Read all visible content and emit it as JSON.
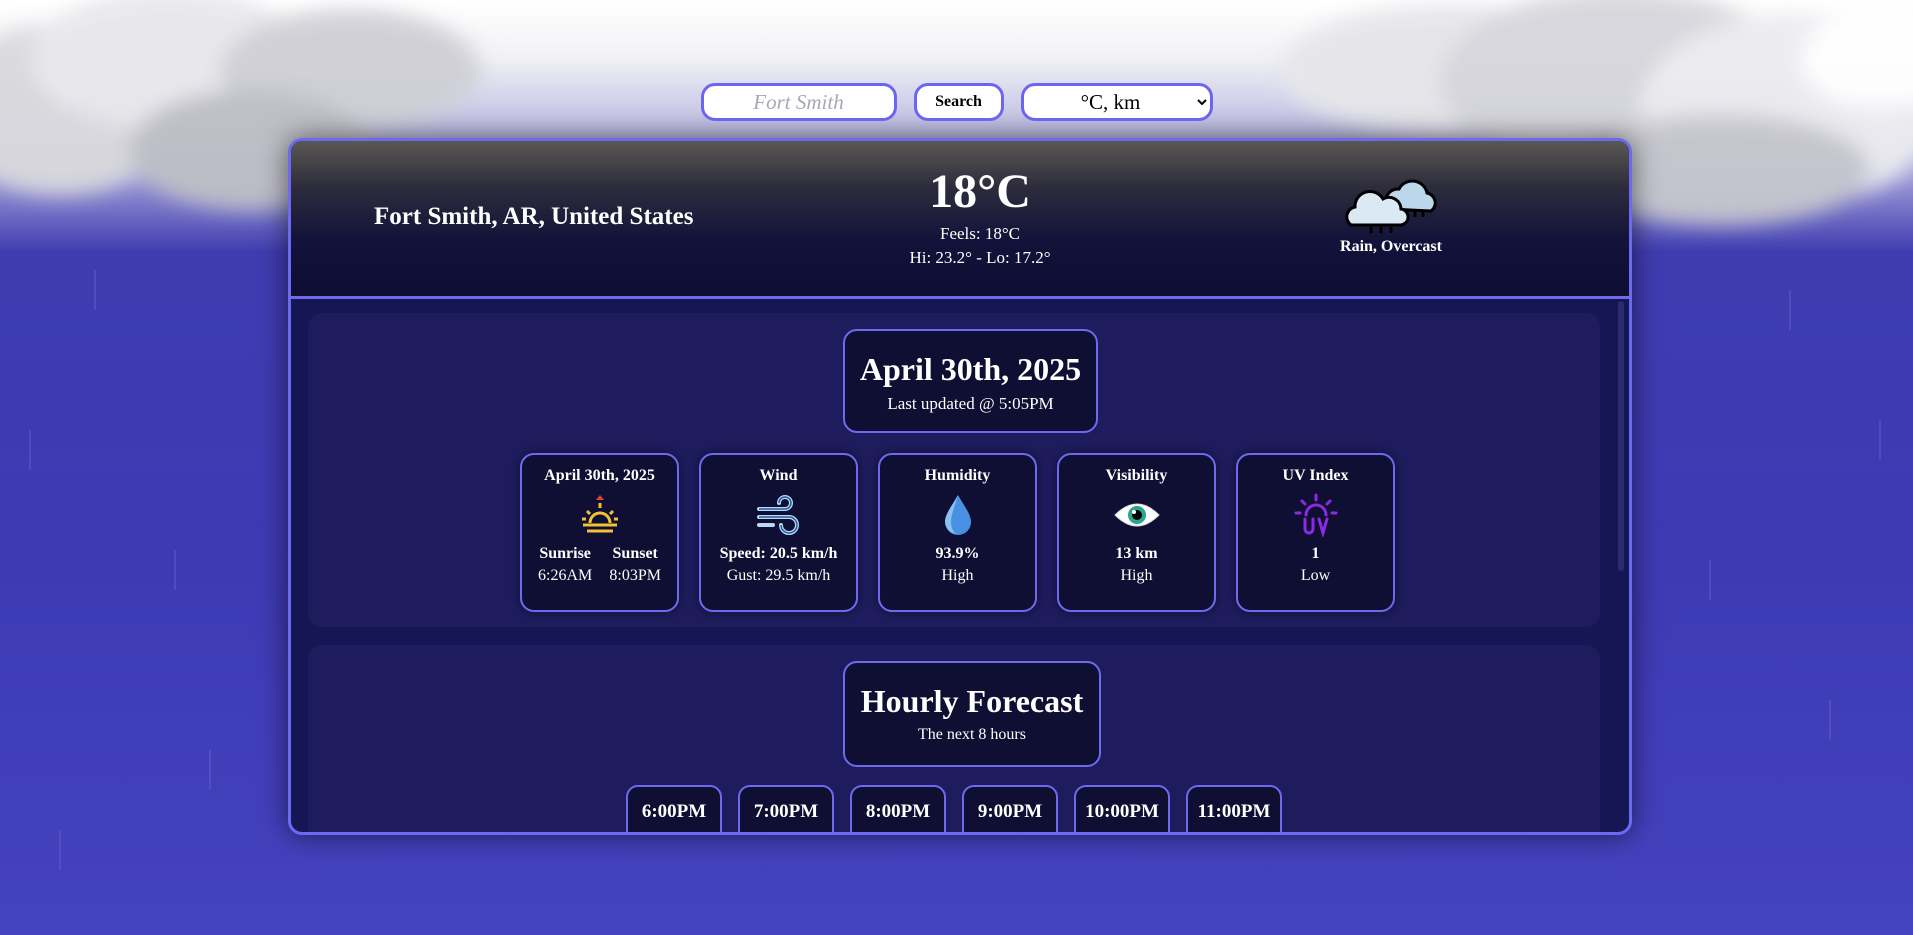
{
  "search": {
    "placeholder": "Fort Smith",
    "button_label": "Search",
    "unit_selected": "°C, km"
  },
  "current": {
    "location": "Fort Smith, AR, United States",
    "temperature": "18°C",
    "feels_like": "Feels: 18°C",
    "hi_lo": "Hi: 23.2° - Lo: 17.2°",
    "condition": "Rain, Overcast",
    "condition_icon": "rain-cloud-icon"
  },
  "today": {
    "date": "April 30th, 2025",
    "last_updated": "Last updated @ 5:05PM"
  },
  "stats": {
    "sun": {
      "title": "April 30th, 2025",
      "icon": "sunrise-icon",
      "sunrise_label": "Sunrise",
      "sunrise_time": "6:26AM",
      "sunset_label": "Sunset",
      "sunset_time": "8:03PM"
    },
    "wind": {
      "title": "Wind",
      "icon": "wind-icon",
      "speed": "Speed: 20.5 km/h",
      "gust": "Gust: 29.5 km/h"
    },
    "humidity": {
      "title": "Humidity",
      "icon": "droplet-icon",
      "value": "93.9%",
      "level": "High"
    },
    "visibility": {
      "title": "Visibility",
      "icon": "eye-icon",
      "value": "13 km",
      "level": "High"
    },
    "uv": {
      "title": "UV Index",
      "icon": "uv-sun-icon",
      "value": "1",
      "level": "Low"
    }
  },
  "hourly": {
    "title": "Hourly Forecast",
    "subtitle": "The next 8 hours",
    "hours": [
      "6:00PM",
      "7:00PM",
      "8:00PM",
      "9:00PM",
      "10:00PM",
      "11:00PM"
    ]
  },
  "colors": {
    "accent": "#6e6af0",
    "card_bg": "#0f0e33",
    "section_bg": "#1e1c5c",
    "sky": "#3f3cb0"
  }
}
